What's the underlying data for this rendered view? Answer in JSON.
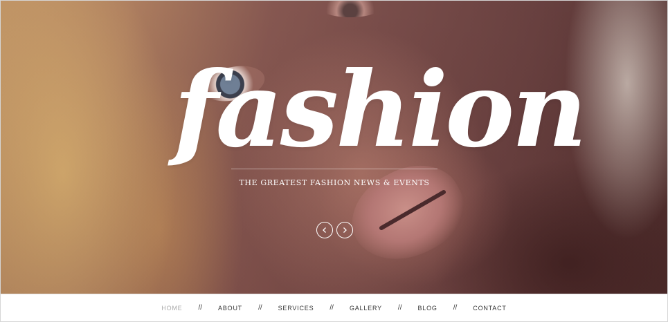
{
  "hero": {
    "logo_text": "fashion",
    "tagline": "THE GREATEST FASHION NEWS & EVENTS",
    "prev_icon": "chevron-left-icon",
    "next_icon": "chevron-right-icon"
  },
  "nav": {
    "separator": "//",
    "items": [
      {
        "label": "HOME",
        "active": true
      },
      {
        "label": "ABOUT",
        "active": false
      },
      {
        "label": "SERVICES",
        "active": false
      },
      {
        "label": "GALLERY",
        "active": false
      },
      {
        "label": "BLOG",
        "active": false
      },
      {
        "label": "CONTACT",
        "active": false
      }
    ]
  },
  "colors": {
    "nav_active": "#a9a9a9",
    "nav_text": "#333333",
    "logo": "#ffffff"
  }
}
